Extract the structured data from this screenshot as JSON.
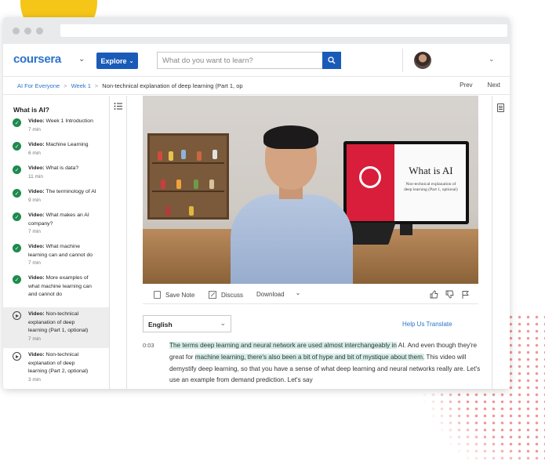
{
  "header": {
    "logo": "coursera",
    "explore_label": "Explore",
    "search_placeholder": "What do you want to learn?"
  },
  "breadcrumb": {
    "items": [
      "AI For Everyone",
      "Week 1"
    ],
    "current": "Non-technical explanation of deep learning (Part 1, op",
    "prev": "Prev",
    "next": "Next"
  },
  "sidebar": {
    "title": "What is AI?",
    "items": [
      {
        "type": "Video:",
        "lines": [
          "Week 1 Introduction"
        ],
        "duration": "7 min",
        "state": "done"
      },
      {
        "type": "Video:",
        "lines": [
          "Machine Learning"
        ],
        "duration": "6 min",
        "state": "done"
      },
      {
        "type": "Video:",
        "lines": [
          "What is data?"
        ],
        "duration": "11 min",
        "state": "done"
      },
      {
        "type": "Video:",
        "lines": [
          "The terminology of AI"
        ],
        "duration": "9 min",
        "state": "done"
      },
      {
        "type": "Video:",
        "lines": [
          "What makes an AI",
          "company?"
        ],
        "duration": "7 min",
        "state": "done"
      },
      {
        "type": "Video:",
        "lines": [
          "What machine",
          "learning can and cannot do"
        ],
        "duration": "7 min",
        "state": "done"
      },
      {
        "type": "Video:",
        "lines": [
          "More examples of",
          "what machine learning can",
          "and cannot do"
        ],
        "duration": "",
        "state": "done"
      },
      {
        "type": "Video:",
        "lines": [
          "Non-technical",
          "explanation of deep",
          "learning (Part 1, optional)"
        ],
        "duration": "7 min",
        "state": "current"
      },
      {
        "type": "Video:",
        "lines": [
          "Non-technical",
          "explanation of deep",
          "learning (Part 2, optional)"
        ],
        "duration": "3 min",
        "state": "todo"
      }
    ]
  },
  "video": {
    "slide_title": "What is AI",
    "slide_subtitle_1": "Non-technical explanation of",
    "slide_subtitle_2": "deep learning (Part 1, optional)"
  },
  "actions": {
    "save_note": "Save Note",
    "discuss": "Discuss",
    "download": "Download"
  },
  "transcript": {
    "language": "English",
    "help": "Help Us Translate",
    "timestamp": "0:03",
    "seg1": "The terms deep learning and neural network are used almost interchangeably in",
    "seg2": " AI. And even though they're great for ",
    "seg3": "machine learning, there's also been a bit of hype and bit of mystique about them.",
    "seg4": " This video will demystify deep learning, so that you have a sense of what deep learning and neural networks really are. Let's use an example from demand prediction. Let's say"
  },
  "colors": {
    "brand_blue": "#2a73cc",
    "button_blue": "#1a5bb8",
    "complete_green": "#1e8a4c",
    "highlight": "#d4eee8"
  }
}
